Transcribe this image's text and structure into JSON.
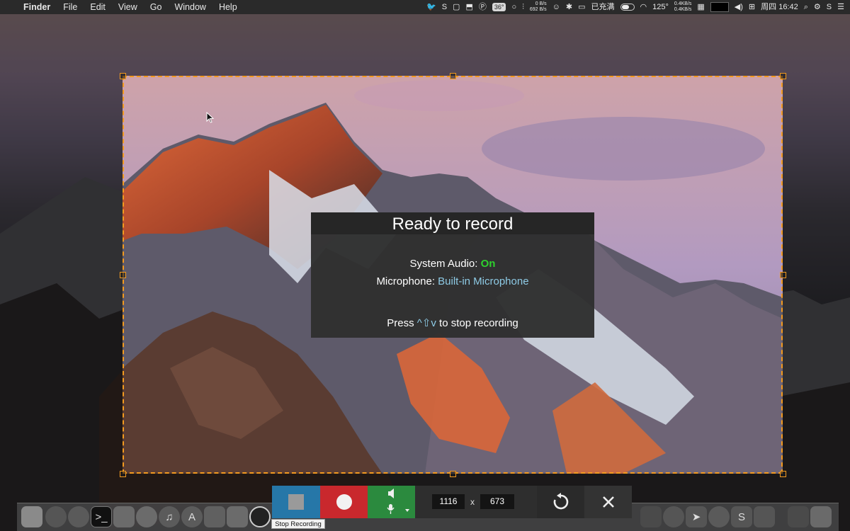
{
  "menubar": {
    "apple_icon": "apple-logo",
    "app_name": "Finder",
    "menus": [
      "File",
      "Edit",
      "View",
      "Go",
      "Window",
      "Help"
    ],
    "status": {
      "temp_badge": "36°",
      "net_up": "0 B/s",
      "net_down": "692 B/s",
      "battery_text": "已充满",
      "cpu_temp": "125°",
      "net2_up": "0.4KB/s",
      "net2_down": "0.4KB/s",
      "datetime": "周四 16:42"
    }
  },
  "dialog": {
    "title": "Ready to record",
    "system_audio_label": "System Audio:",
    "system_audio_value": "On",
    "microphone_label": "Microphone:",
    "microphone_value": "Built-in Microphone",
    "press_label": "Press",
    "shortcut": "^⇧v",
    "stop_suffix": "to stop recording"
  },
  "toolbar": {
    "width_value": "1116",
    "x_separator": "x",
    "height_value": "673",
    "tooltip": "Stop Recording",
    "colors": {
      "stop": "#2677a8",
      "record": "#c9282d",
      "audio": "#2b8a3e"
    }
  },
  "selection": {
    "border_color": "#f39a1f"
  }
}
